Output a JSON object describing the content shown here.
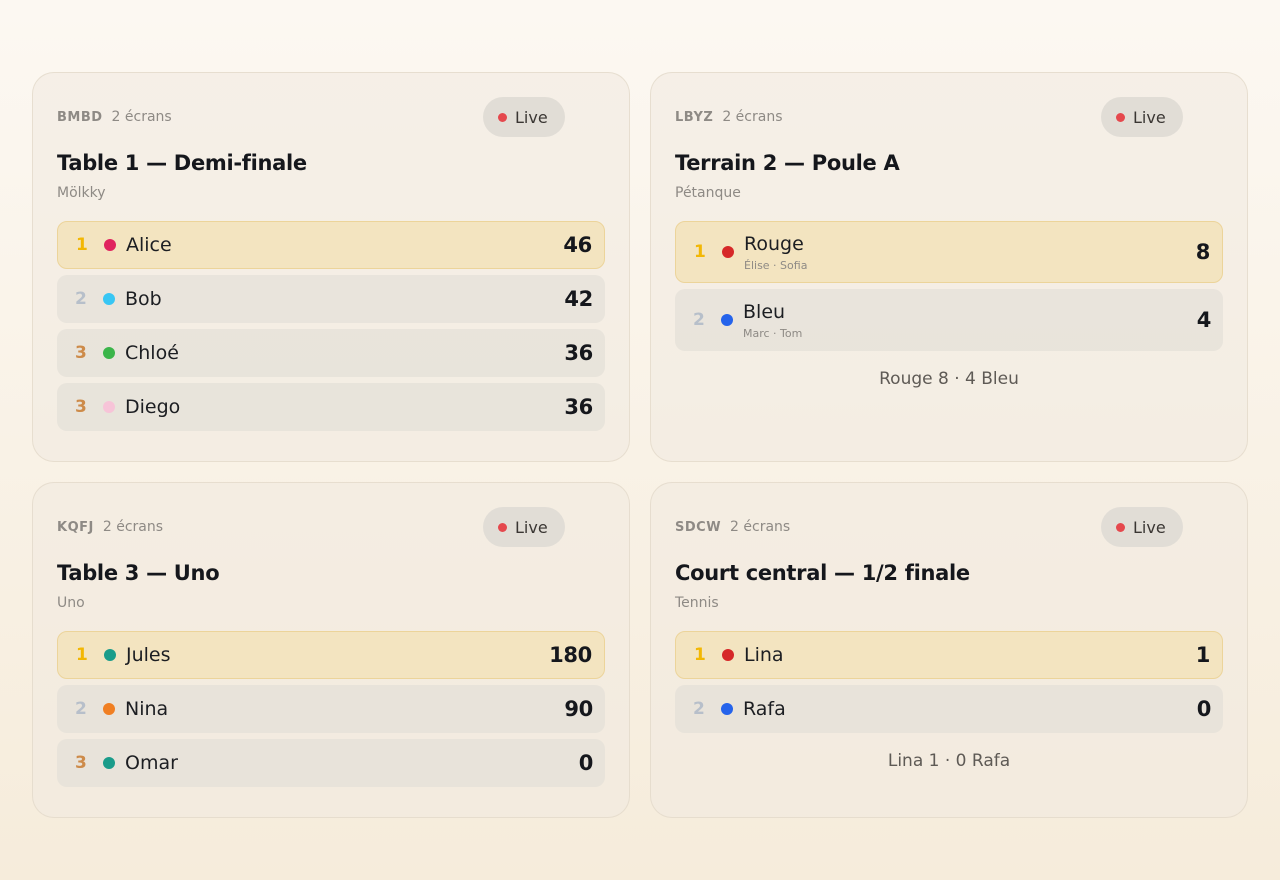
{
  "cards": [
    {
      "code": "BMBD",
      "screens": "2 écrans",
      "live": "Live",
      "title": "Table 1 — Demi-finale",
      "game": "Mölkky",
      "rows": [
        {
          "rank": "1",
          "name": "Alice",
          "score": "46",
          "color": "#e0245e"
        },
        {
          "rank": "2",
          "name": "Bob",
          "score": "42",
          "color": "#38c6f4"
        },
        {
          "rank": "3",
          "name": "Chloé",
          "score": "36",
          "color": "#3bb54a"
        },
        {
          "rank": "3",
          "name": "Diego",
          "score": "36",
          "color": "#f7c4d8"
        }
      ]
    },
    {
      "code": "LBYZ",
      "screens": "2 écrans",
      "live": "Live",
      "title": "Terrain 2 — Poule A",
      "game": "Pétanque",
      "rows": [
        {
          "rank": "1",
          "name": "Rouge",
          "members": "Élise · Sofia",
          "score": "8",
          "color": "#d62828"
        },
        {
          "rank": "2",
          "name": "Bleu",
          "members": "Marc · Tom",
          "score": "4",
          "color": "#2563eb"
        }
      ],
      "summary": "Rouge 8 · 4 Bleu"
    },
    {
      "code": "KQFJ",
      "screens": "2 écrans",
      "live": "Live",
      "title": "Table 3 — Uno",
      "game": "Uno",
      "rows": [
        {
          "rank": "1",
          "name": "Jules",
          "score": "180",
          "color": "#1a9c8a"
        },
        {
          "rank": "2",
          "name": "Nina",
          "score": "90",
          "color": "#f07f22"
        },
        {
          "rank": "3",
          "name": "Omar",
          "score": "0",
          "color": "#1a9c8a"
        }
      ]
    },
    {
      "code": "SDCW",
      "screens": "2 écrans",
      "live": "Live",
      "title": "Court central — 1/2 finale",
      "game": "Tennis",
      "rows": [
        {
          "rank": "1",
          "name": "Lina",
          "score": "1",
          "color": "#d62828"
        },
        {
          "rank": "2",
          "name": "Rafa",
          "score": "0",
          "color": "#2563eb"
        }
      ],
      "summary": "Lina 1 · 0 Rafa"
    }
  ],
  "colors": {
    "live_dot": "#e5484d",
    "rank_gold": "#f2b705",
    "rank_silver": "#b7bfca",
    "rank_bronze": "#cd8b4a"
  }
}
